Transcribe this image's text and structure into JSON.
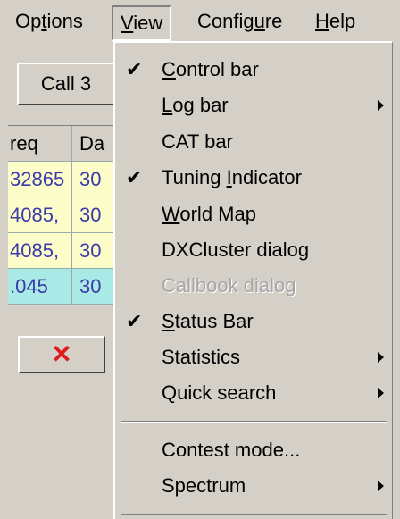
{
  "menubar": {
    "items": [
      {
        "pre": "Op",
        "ul": "t",
        "post": "ions"
      },
      {
        "pre": "",
        "ul": "V",
        "post": "iew"
      },
      {
        "pre": "Config",
        "ul": "u",
        "post": "re"
      },
      {
        "pre": "",
        "ul": "H",
        "post": "elp"
      }
    ]
  },
  "left": {
    "call_button": "Call 3",
    "grid": {
      "headers": [
        "req",
        "Da"
      ],
      "rows": [
        [
          "32865",
          "30"
        ],
        [
          "4085,",
          "30"
        ],
        [
          "4085,",
          "30"
        ],
        [
          ".045",
          "30"
        ]
      ]
    },
    "delete_button": "✕"
  },
  "view_menu": {
    "items": [
      {
        "check": "✔",
        "pre": "",
        "ul": "C",
        "post": "ontrol bar",
        "submenu": false,
        "disabled": false
      },
      {
        "check": "",
        "pre": "",
        "ul": "L",
        "post": "og bar",
        "submenu": true,
        "disabled": false
      },
      {
        "check": "",
        "pre": "CAT bar",
        "ul": "",
        "post": "",
        "submenu": false,
        "disabled": false
      },
      {
        "check": "✔",
        "pre": "Tuning ",
        "ul": "I",
        "post": "ndicator",
        "submenu": false,
        "disabled": false
      },
      {
        "check": "",
        "pre": "",
        "ul": "W",
        "post": "orld Map",
        "submenu": false,
        "disabled": false
      },
      {
        "check": "",
        "pre": "DXCluster dialog",
        "ul": "",
        "post": "",
        "submenu": false,
        "disabled": false
      },
      {
        "check": "",
        "pre": "Callbook dialog",
        "ul": "",
        "post": "",
        "submenu": false,
        "disabled": true
      },
      {
        "check": "✔",
        "pre": "",
        "ul": "S",
        "post": "tatus Bar",
        "submenu": false,
        "disabled": false
      },
      {
        "check": "",
        "pre": "Statistics",
        "ul": "",
        "post": "",
        "submenu": true,
        "disabled": false
      },
      {
        "check": "",
        "pre": "Quick search",
        "ul": "",
        "post": "",
        "submenu": true,
        "disabled": false
      },
      {
        "check": "",
        "pre": "Contest mode...",
        "ul": "",
        "post": "",
        "submenu": false,
        "disabled": false
      },
      {
        "check": "",
        "pre": "Spectrum",
        "ul": "",
        "post": "",
        "submenu": true,
        "disabled": false
      }
    ]
  }
}
